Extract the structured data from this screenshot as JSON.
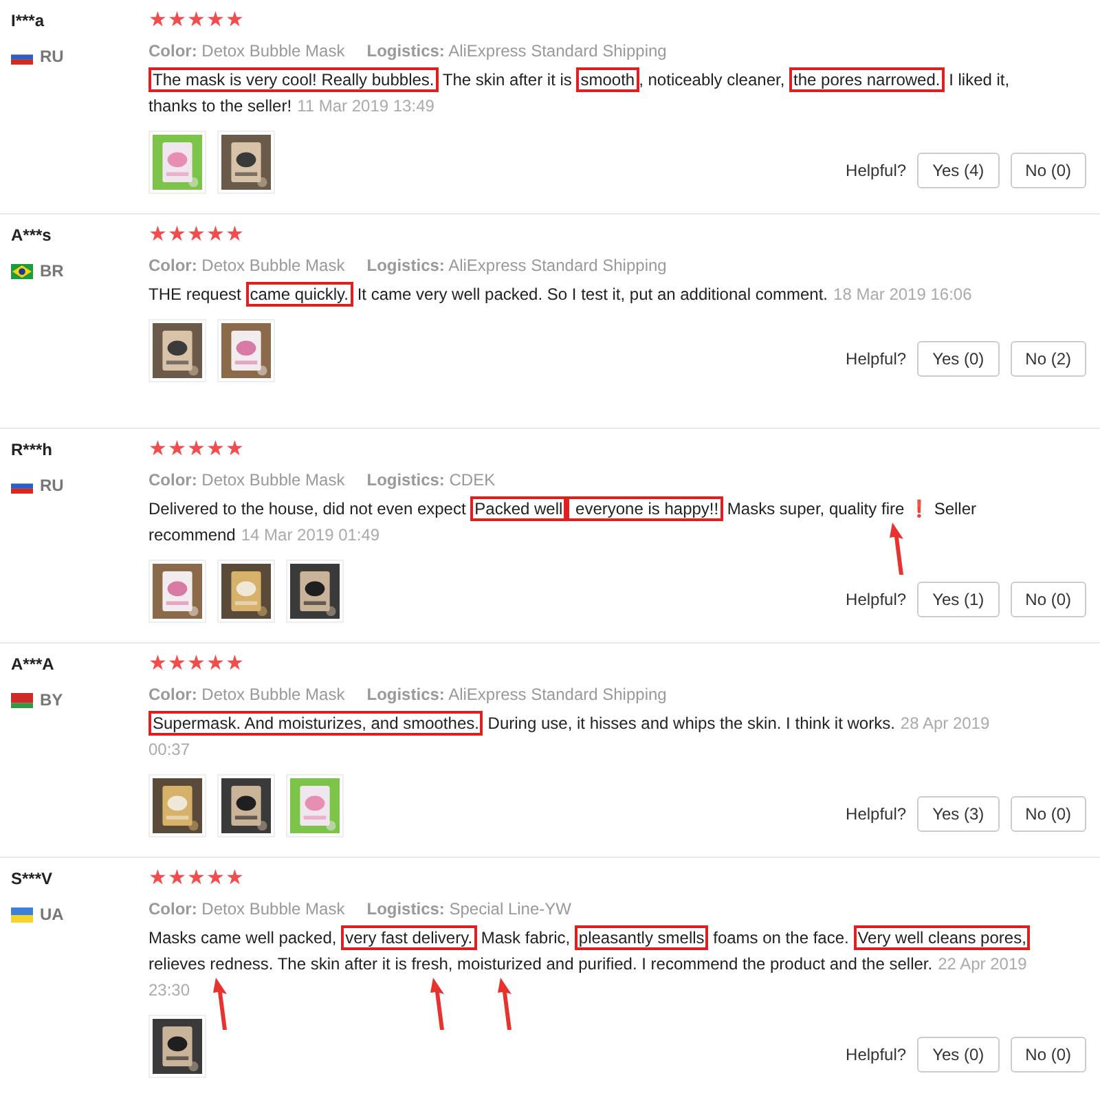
{
  "reviews": [
    {
      "user": "I***a",
      "country": "RU",
      "flag": {
        "kind": "ru"
      },
      "stars": 5,
      "color_label": "Color:",
      "color_value": "Detox Bubble Mask",
      "logistics_label": "Logistics:",
      "logistics_value": "AliExpress Standard Shipping",
      "segments": [
        {
          "text": "The mask is very cool! Really bubbles.",
          "kind": "boxed"
        },
        {
          "text": " The skin after it is ",
          "kind": "plain"
        },
        {
          "text": "smooth",
          "kind": "boxed"
        },
        {
          "text": ", noticeably cleaner, ",
          "kind": "plain"
        },
        {
          "text": "the pores narrowed.",
          "kind": "boxed"
        },
        {
          "text": " I liked it, thanks to the seller!",
          "kind": "plain"
        }
      ],
      "date": "11 Mar 2019 13:49",
      "photos": [
        {
          "kind": "picture"
        },
        {
          "kind": "picture"
        }
      ],
      "helpful_label": "Helpful?",
      "yes": "Yes (4)",
      "no": "No (0)"
    },
    {
      "user": "A***s",
      "country": "BR",
      "flag": {
        "kind": "br"
      },
      "stars": 5,
      "color_label": "Color:",
      "color_value": "Detox Bubble Mask",
      "logistics_label": "Logistics:",
      "logistics_value": "AliExpress Standard Shipping",
      "segments": [
        {
          "text": "THE request ",
          "kind": "plain"
        },
        {
          "text": "came quickly.",
          "kind": "boxed"
        },
        {
          "text": " It came very well packed. So I test it, put an additional comment.",
          "kind": "plain"
        }
      ],
      "date": "18 Mar 2019 16:06",
      "photos": [
        {
          "kind": "picture"
        },
        {
          "kind": "picture"
        }
      ],
      "helpful_label": "Helpful?",
      "yes": "Yes (0)",
      "no": "No (2)"
    },
    {
      "user": "R***h",
      "country": "RU",
      "flag": {
        "kind": "ru"
      },
      "stars": 5,
      "color_label": "Color:",
      "color_value": "Detox Bubble Mask",
      "logistics_label": "Logistics:",
      "logistics_value": "CDEK",
      "segments": [
        {
          "text": "Delivered to the house, did not even expect ",
          "kind": "plain"
        },
        {
          "text": "Packed well",
          "kind": "boxed"
        },
        {
          "text": " everyone is happy!!",
          "kind": "boxed"
        },
        {
          "text": " Masks super, quality ",
          "kind": "plain"
        },
        {
          "text": "fire",
          "kind": "pointed"
        },
        {
          "text": " ❗",
          "kind": "emoji"
        },
        {
          "text": " Seller recommend",
          "kind": "plain"
        }
      ],
      "date": "14 Mar 2019 01:49",
      "photos": [
        {
          "kind": "picture"
        },
        {
          "kind": "picture"
        },
        {
          "kind": "picture"
        }
      ],
      "helpful_label": "Helpful?",
      "yes": "Yes (1)",
      "no": "No (0)"
    },
    {
      "user": "A***A",
      "country": "BY",
      "flag": {
        "kind": "by"
      },
      "stars": 5,
      "color_label": "Color:",
      "color_value": "Detox Bubble Mask",
      "logistics_label": "Logistics:",
      "logistics_value": "AliExpress Standard Shipping",
      "segments": [
        {
          "text": "Supermask. And moisturizes, and smoothes.",
          "kind": "boxed"
        },
        {
          "text": " During use, it hisses and whips the skin. I think it works.",
          "kind": "plain"
        }
      ],
      "date": "28 Apr 2019 00:37",
      "photos": [
        {
          "kind": "picture"
        },
        {
          "kind": "picture"
        },
        {
          "kind": "picture"
        }
      ],
      "helpful_label": "Helpful?",
      "yes": "Yes (3)",
      "no": "No (0)"
    },
    {
      "user": "S***V",
      "country": "UA",
      "flag": {
        "kind": "ua"
      },
      "stars": 5,
      "color_label": "Color:",
      "color_value": "Detox Bubble Mask",
      "logistics_label": "Logistics:",
      "logistics_value": "Special Line-YW",
      "segments": [
        {
          "text": "Masks came well packed, ",
          "kind": "plain"
        },
        {
          "text": "very fast delivery.",
          "kind": "boxed"
        },
        {
          "text": " Mask fabric, ",
          "kind": "plain"
        },
        {
          "text": "pleasantly smells",
          "kind": "boxed"
        },
        {
          "text": " foams on the face. ",
          "kind": "plain"
        },
        {
          "text": "Very well cleans pores,",
          "kind": "boxed"
        },
        {
          "text": " relieves redness.",
          "kind": "pointed"
        },
        {
          "text": " The skin after it is ",
          "kind": "plain"
        },
        {
          "text": "fresh,",
          "kind": "pointed"
        },
        {
          "text": " moisturized",
          "kind": "pointed"
        },
        {
          "text": " and purified. I recommend the product and the seller.",
          "kind": "plain"
        }
      ],
      "date": "22 Apr 2019 23:30",
      "photos": [
        {
          "kind": "picture"
        }
      ],
      "helpful_label": "Helpful?",
      "yes": "Yes (0)",
      "no": "No (0)"
    }
  ]
}
